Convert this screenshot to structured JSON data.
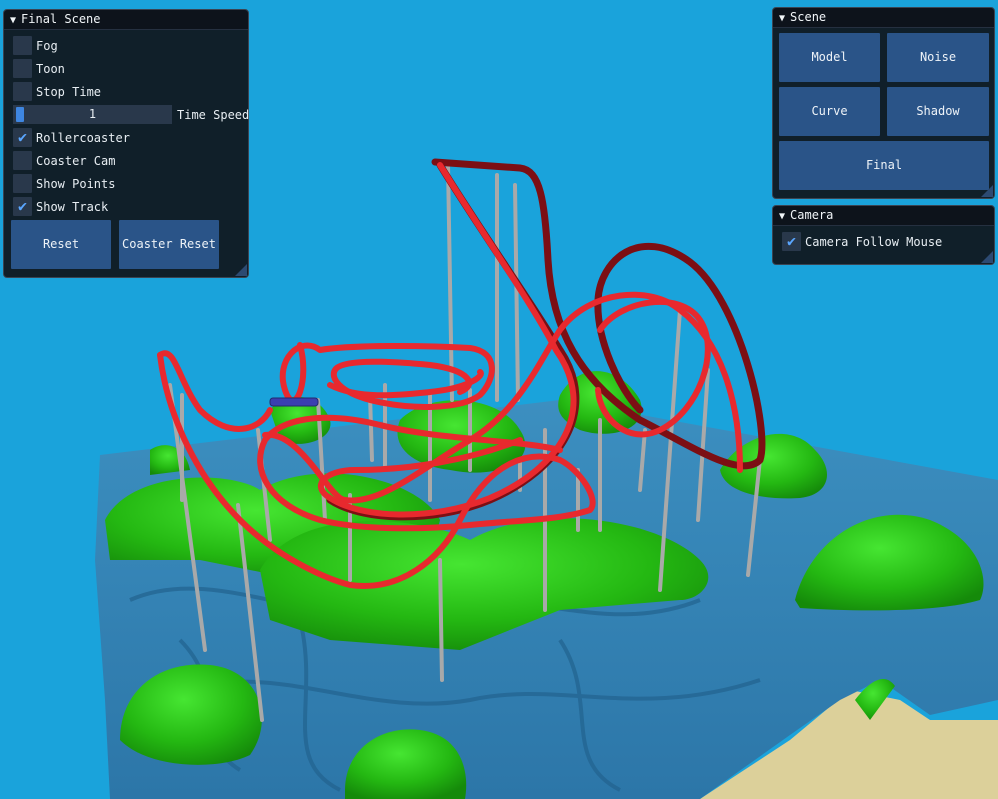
{
  "final_scene": {
    "title": "Final Scene",
    "fog": {
      "label": "Fog",
      "checked": false
    },
    "toon": {
      "label": "Toon",
      "checked": false
    },
    "stop_time": {
      "label": "Stop Time",
      "checked": false
    },
    "time_speed": {
      "label": "Time Speed",
      "value": "1"
    },
    "rollercoaster": {
      "label": "Rollercoaster",
      "checked": true
    },
    "coaster_cam": {
      "label": "Coaster Cam",
      "checked": false
    },
    "show_points": {
      "label": "Show Points",
      "checked": false
    },
    "show_track": {
      "label": "Show Track",
      "checked": true
    },
    "reset_button": "Reset",
    "coaster_reset_button": "Coaster Reset"
  },
  "scene_panel": {
    "title": "Scene",
    "buttons": {
      "model": "Model",
      "noise": "Noise",
      "curve": "Curve",
      "shadow": "Shadow",
      "final": "Final"
    }
  },
  "camera_panel": {
    "title": "Camera",
    "follow_mouse": {
      "label": "Camera Follow Mouse",
      "checked": true
    }
  },
  "icons": {
    "collapse": "triangle-down-icon",
    "check": "checkmark-icon"
  },
  "colors": {
    "sky": "#1aa3db",
    "track": "#e8292e",
    "track_shadow": "#7c0f14",
    "grass": "#2ec21a",
    "water": "#2a7fb3",
    "sand": "#dcd09a",
    "support": "#a9a9a9",
    "accent": "#3e86e0"
  }
}
